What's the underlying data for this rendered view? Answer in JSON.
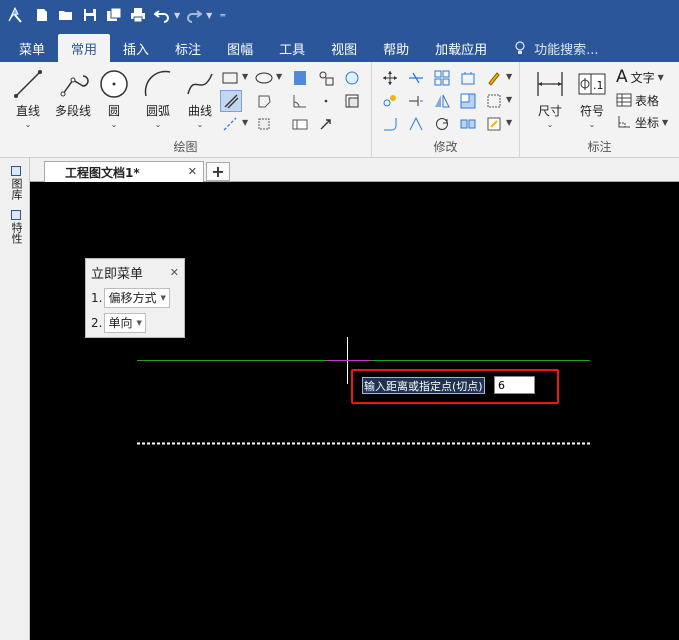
{
  "quick_access": {
    "icons": [
      "app-logo-icon",
      "new-file-icon",
      "open-folder-icon",
      "save-icon",
      "save-all-icon",
      "print-icon",
      "undo-icon",
      "redo-icon",
      "customize-qat-icon"
    ]
  },
  "menu_tabs": [
    {
      "label": "菜单"
    },
    {
      "label": "常用",
      "active": true
    },
    {
      "label": "插入"
    },
    {
      "label": "标注"
    },
    {
      "label": "图幅"
    },
    {
      "label": "工具"
    },
    {
      "label": "视图"
    },
    {
      "label": "帮助"
    },
    {
      "label": "加载应用"
    }
  ],
  "search": {
    "placeholder": "功能搜索..."
  },
  "ribbon": {
    "draw": {
      "label": "绘图",
      "buttons": [
        {
          "label": "直线"
        },
        {
          "label": "多段线"
        },
        {
          "label": "圆"
        },
        {
          "label": "圆弧"
        },
        {
          "label": "曲线"
        }
      ]
    },
    "modify": {
      "label": "修改"
    },
    "annotate": {
      "label": "标注",
      "dimension": "尺寸",
      "symbol": "符号",
      "text": "文字",
      "table": "表格",
      "coordinate": "坐标"
    }
  },
  "document": {
    "tab_title": "工程图文档1*"
  },
  "side_panels": [
    {
      "label": "图库"
    },
    {
      "label": "特性"
    }
  ],
  "immediate_menu": {
    "title": "立即菜单",
    "rows": [
      {
        "num": "1.",
        "value": "偏移方式"
      },
      {
        "num": "2.",
        "value": "单向"
      }
    ]
  },
  "command_prompt": {
    "label": "输入距离或指定点(切点)",
    "value": "6"
  },
  "colors": {
    "accent": "#2b579a",
    "canvas": "#000000",
    "reference_line": "#21a321",
    "offset_preview": "#ffffff",
    "highlight": "#e81818"
  }
}
